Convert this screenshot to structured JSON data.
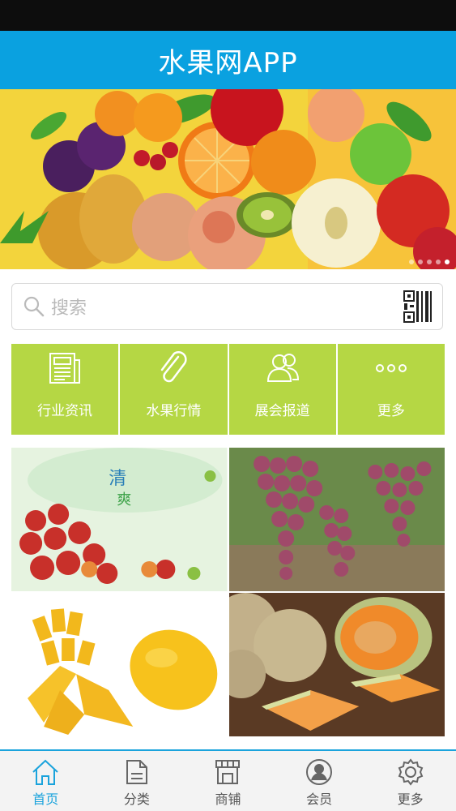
{
  "header": {
    "title": "水果网APP"
  },
  "banner": {
    "slide_count": 5,
    "active_slide": 5,
    "image": "fruit-assortment-banner"
  },
  "search": {
    "placeholder": "搜索",
    "icon": "search-icon",
    "scan_icon": "qr-scan-icon"
  },
  "categories": [
    {
      "label": "行业资讯",
      "icon": "newspaper-icon"
    },
    {
      "label": "水果行情",
      "icon": "paperclip-icon"
    },
    {
      "label": "展会报道",
      "icon": "people-icon"
    },
    {
      "label": "更多",
      "icon": "more-dots-icon"
    }
  ],
  "photos": [
    {
      "image": "apples-photo"
    },
    {
      "image": "grapes-photo"
    },
    {
      "image": "mango-photo"
    },
    {
      "image": "cantaloupe-photo"
    }
  ],
  "tabbar": {
    "items": [
      {
        "label": "首页",
        "icon": "home-icon",
        "active": true
      },
      {
        "label": "分类",
        "icon": "category-icon",
        "active": false
      },
      {
        "label": "商铺",
        "icon": "shop-icon",
        "active": false
      },
      {
        "label": "会员",
        "icon": "member-icon",
        "active": false
      },
      {
        "label": "更多",
        "icon": "gear-icon",
        "active": false
      }
    ]
  },
  "colors": {
    "header": "#0aa1e0",
    "category_bg": "#b5d744",
    "tab_active": "#1aa3dc"
  }
}
